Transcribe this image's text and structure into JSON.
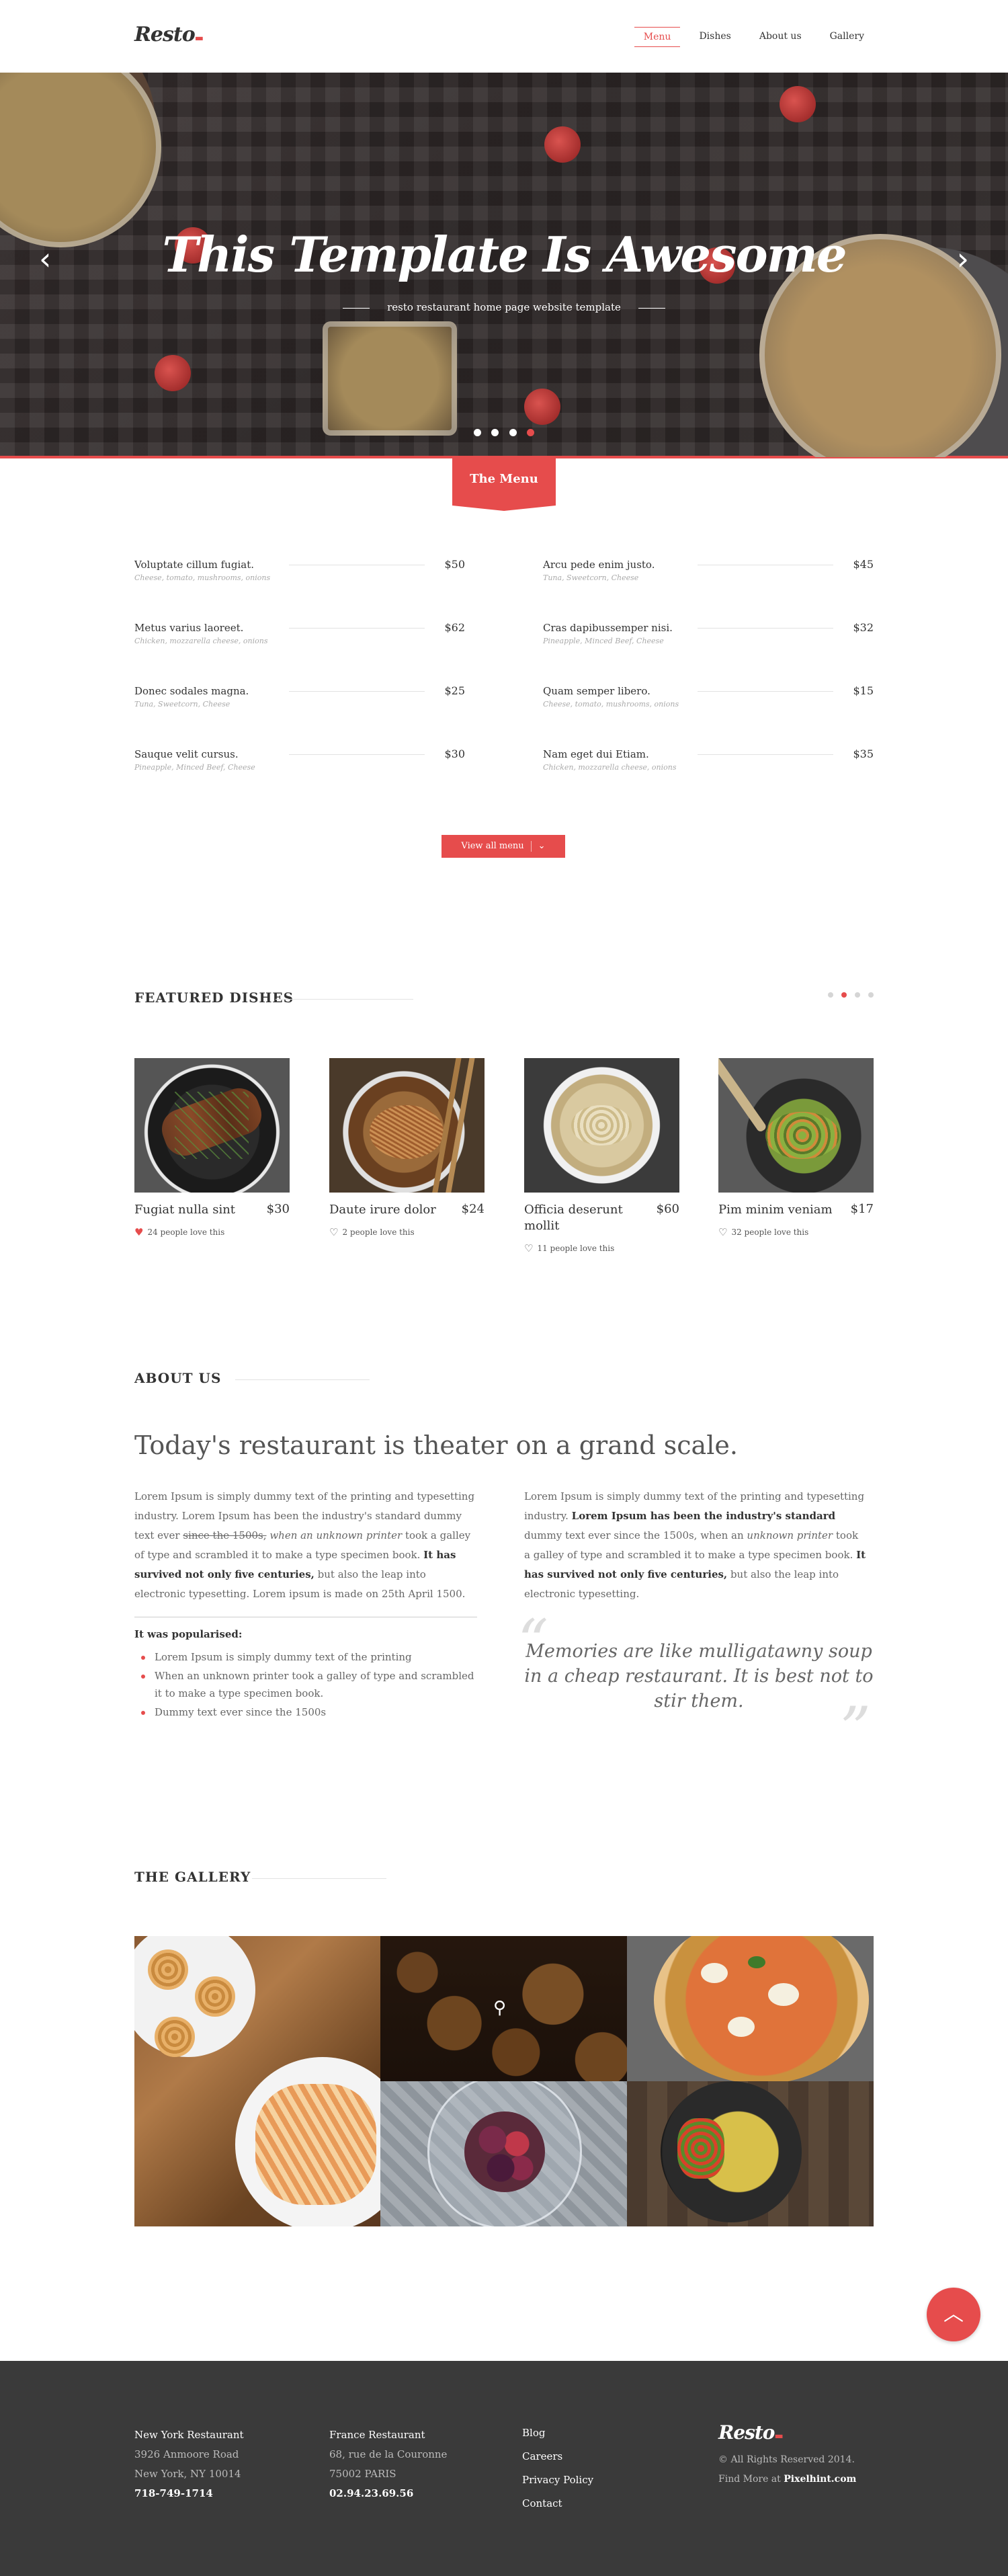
{
  "header": {
    "logo": "Resto",
    "nav": [
      "Menu",
      "Dishes",
      "About us",
      "Gallery"
    ],
    "active_nav": "Menu"
  },
  "hero": {
    "title": "This Template Is Awesome",
    "subtitle": "resto restaurant home page website template",
    "slides": 4,
    "active_slide": 4
  },
  "menu": {
    "tab_label": "The Menu",
    "items": [
      {
        "name": "Voluptate cillum fugiat.",
        "desc": "Cheese, tomato, mushrooms, onions",
        "price": "$50"
      },
      {
        "name": "Arcu pede enim justo.",
        "desc": "Tuna, Sweetcorn, Cheese",
        "price": "$45"
      },
      {
        "name": "Metus varius laoreet.",
        "desc": "Chicken, mozzarella cheese, onions",
        "price": "$62"
      },
      {
        "name": "Cras dapibussemper nisi.",
        "desc": "Pineapple, Minced Beef, Cheese",
        "price": "$32"
      },
      {
        "name": "Donec sodales magna.",
        "desc": "Tuna, Sweetcorn, Cheese",
        "price": "$25"
      },
      {
        "name": "Quam semper libero.",
        "desc": "Cheese, tomato, mushrooms, onions",
        "price": "$15"
      },
      {
        "name": "Sauque velit cursus.",
        "desc": "Pineapple, Minced Beef, Cheese",
        "price": "$30"
      },
      {
        "name": "Nam eget dui Etiam.",
        "desc": "Chicken, mozzarella cheese, onions",
        "price": "$35"
      }
    ],
    "view_all": "View all menu"
  },
  "featured": {
    "title": "FEATURED DISHES",
    "dishes": [
      {
        "name": "Fugiat nulla sint",
        "price": "$30",
        "likes": "24 people love this",
        "liked": true
      },
      {
        "name": "Daute irure dolor",
        "price": "$24",
        "likes": "2 people love this",
        "liked": false
      },
      {
        "name": "Officia deserunt mollit",
        "price": "$60",
        "likes": "11 people love this",
        "liked": false
      },
      {
        "name": "Pim minim veniam",
        "price": "$17",
        "likes": "32 people love this",
        "liked": false
      }
    ]
  },
  "about": {
    "title": "ABOUT US",
    "headline": "Today's restaurant is theater on a grand scale.",
    "col1": {
      "p1": "Lorem Ipsum is simply dummy text of the printing and typesetting industry. Lorem Ipsum has been the industry's standard dummy text ever",
      "p1_strike": "since the 1500s,",
      "p1_em": "when an unknown printer",
      "p1_tail": "took a galley of type and scrambled it to make a type specimen book.",
      "p2_bold": "It has survived not only five centuries,",
      "p2_tail": "but also the leap into electronic typesetting. Lorem ipsum is made on 25th April 1500."
    },
    "col2": {
      "p1": "Lorem Ipsum is simply dummy text of the printing and typesetting industry.",
      "p1_bold": "Lorem Ipsum has been the industry's standard",
      "p1_tail": "dummy text ever since the 1500s, when an",
      "p1_em": "unknown printer",
      "p1_tail2": "took a galley of type and scrambled it to make a type specimen book.",
      "p2_bold": "It has survived not only five centuries,",
      "p2_tail": "but also the leap into electronic typesetting."
    },
    "popularised_title": "It was popularised:",
    "popularised": [
      "Lorem Ipsum is simply dummy text of the printing",
      "When an unknown printer took a galley of type and scrambled it to make a type specimen book.",
      "Dummy text ever since the 1500s"
    ],
    "quote": "Memories are like mulligatawny soup in a cheap restaurant. It is best not to stir them."
  },
  "gallery": {
    "title": "THE GALLERY",
    "tiles": [
      "pastries",
      "croissants",
      "pizza",
      "berries",
      "pasta-bowl"
    ]
  },
  "footer": {
    "ny": {
      "title": "New York Restaurant",
      "line1": "3926 Anmoore Road",
      "line2": "New York, NY 10014",
      "phone": "718-749-1714"
    },
    "fr": {
      "title": "France Restaurant",
      "line1": "68, rue de la Couronne",
      "line2": "75002 PARIS",
      "phone": "02.94.23.69.56"
    },
    "links": [
      "Blog",
      "Careers",
      "Privacy Policy",
      "Contact"
    ],
    "logo": "Resto",
    "rights": "© All Rights Reserved 2014.",
    "find_prefix": "Find More at",
    "find_site": "Pixelhint.com"
  },
  "colors": {
    "accent": "#e64c4c",
    "footer_bg": "#3a3a3a",
    "text": "#333333"
  },
  "icons": [
    "chevron-left-icon",
    "chevron-right-icon",
    "chevron-down-icon",
    "heart-icon",
    "search-icon",
    "arrow-up-icon"
  ]
}
